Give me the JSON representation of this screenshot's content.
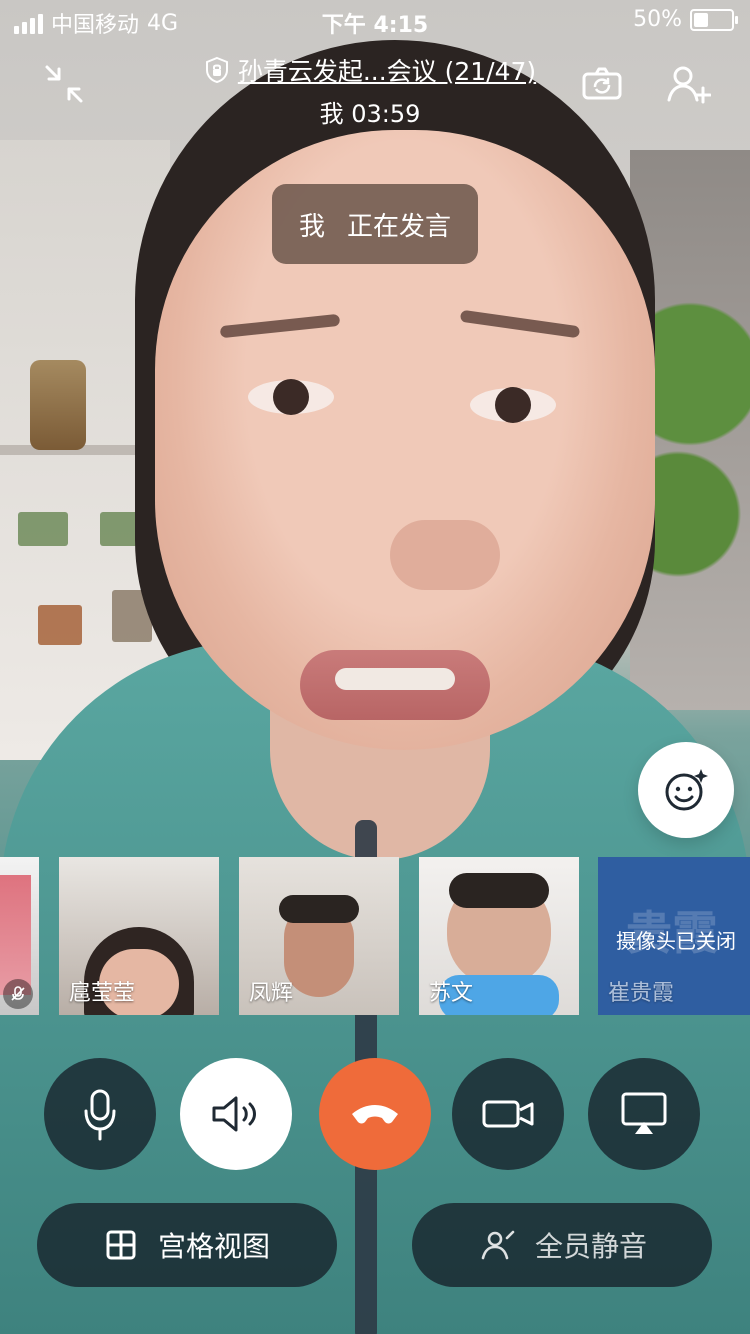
{
  "status_bar": {
    "carrier": "中国移动",
    "network": "4G",
    "time": "下午 4:15",
    "battery": "50%"
  },
  "meeting": {
    "title": "孙青云发起...会议 (21/47)",
    "timer": "我 03:59"
  },
  "speaking_indicator": {
    "speaker": "我",
    "status": "正在发言"
  },
  "thumbnails": [
    {
      "name": ""
    },
    {
      "name": "扈莹莹"
    },
    {
      "name": "凤辉"
    },
    {
      "name": "苏文"
    },
    {
      "name": "崔贵霞",
      "camera_off_text": "摄像头已关闭",
      "avatar_text": "贵霞"
    }
  ],
  "controls": {
    "mic": "mic-icon",
    "speaker": "speaker-icon",
    "hangup": "hangup-icon",
    "camera": "camera-icon",
    "screen_share": "screen-share-icon"
  },
  "bottom_actions": {
    "grid_view": "宫格视图",
    "mute_all": "全员静音"
  },
  "colors": {
    "hangup": "#ef6b3a",
    "control_bg": "#141c26",
    "thumbnail_camera_off_bg": "#2f5ea1"
  }
}
